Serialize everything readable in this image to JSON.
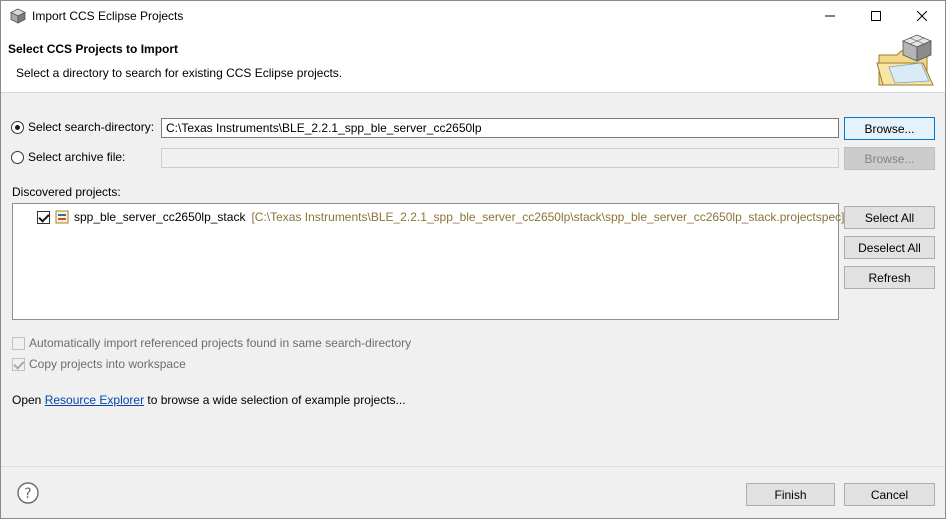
{
  "window": {
    "title": "Import CCS Eclipse Projects",
    "controls": {
      "minimize": "–",
      "maximize": "☐",
      "close": "✕"
    }
  },
  "header": {
    "title": "Select CCS Projects to Import",
    "description": "Select a directory to search for existing CCS Eclipse projects.",
    "image_icon": "folder-cube-icon"
  },
  "search_directory": {
    "label": "Select search-directory:",
    "selected": true,
    "value": "C:\\Texas Instruments\\BLE_2.2.1_spp_ble_server_cc2650lp",
    "browse_label": "Browse..."
  },
  "archive_file": {
    "label": "Select archive file:",
    "selected": false,
    "value": "",
    "browse_label": "Browse..."
  },
  "discovered": {
    "label": "Discovered projects:",
    "projects": [
      {
        "name": "spp_ble_server_cc2650lp_stack",
        "path": "[C:\\Texas Instruments\\BLE_2.2.1_spp_ble_server_cc2650lp\\stack\\spp_ble_server_cc2650lp_stack.projectspec]",
        "checked": true
      }
    ],
    "select_all_label": "Select All",
    "deselect_all_label": "Deselect All",
    "refresh_label": "Refresh"
  },
  "options": {
    "auto_import_label": "Automatically import referenced projects found in same search-directory",
    "auto_import_checked": false,
    "copy_label": "Copy projects into workspace",
    "copy_checked": true
  },
  "resource_link": {
    "prefix": "Open ",
    "link_text": "Resource Explorer",
    "suffix": " to browse a wide selection of example projects..."
  },
  "footer": {
    "help_icon": "help-icon",
    "finish_label": "Finish",
    "cancel_label": "Cancel"
  },
  "colors": {
    "focus_border": "#0078d7",
    "link": "#0645ad",
    "path_text": "#8a7436"
  }
}
